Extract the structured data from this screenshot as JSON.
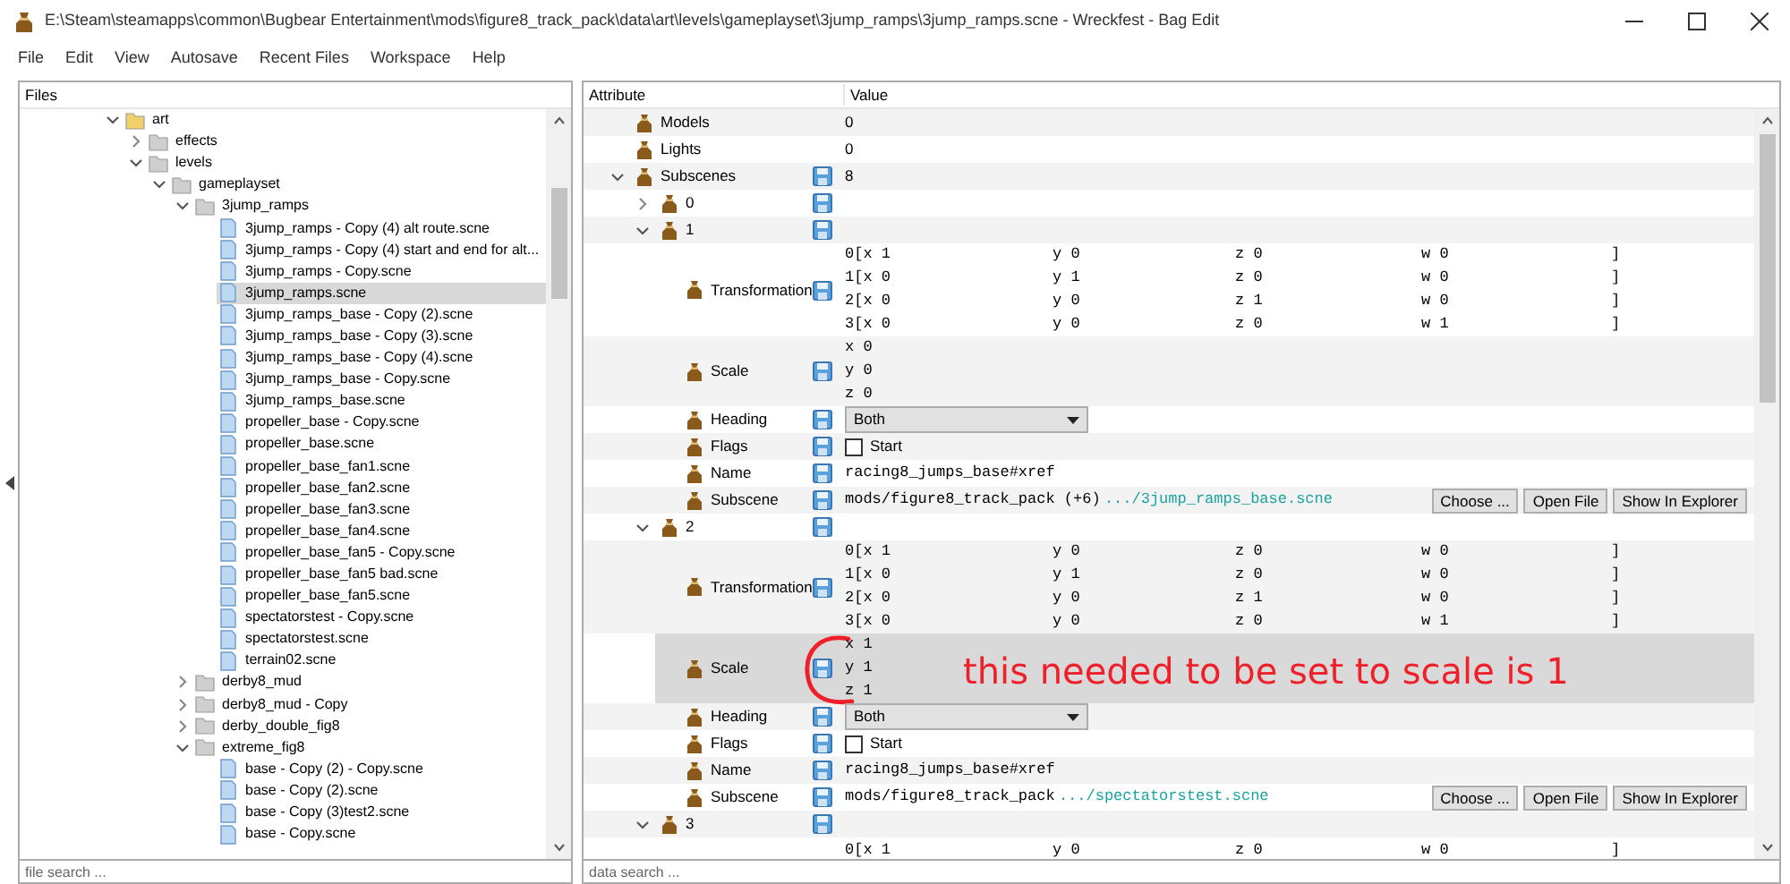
{
  "window": {
    "title": "E:\\Steam\\steamapps\\common\\Bugbear Entertainment\\mods\\figure8_track_pack\\data\\art\\levels\\gameplayset\\3jump_ramps\\3jump_ramps.scne - Wreckfest - Bag Edit"
  },
  "menu": [
    "File",
    "Edit",
    "View",
    "Autosave",
    "Recent Files",
    "Workspace",
    "Help"
  ],
  "files_panel": {
    "title": "Files",
    "search_placeholder": "file search ...",
    "tree": [
      {
        "kind": "folder",
        "label": "art",
        "color": "#f2d06b",
        "expanded": true,
        "selected": false,
        "children": [
          {
            "kind": "folder",
            "label": "effects",
            "color": "#cfcfcf",
            "expanded": false,
            "selected": false
          },
          {
            "kind": "folder",
            "label": "levels",
            "color": "#cfcfcf",
            "expanded": true,
            "selected": false,
            "children": [
              {
                "kind": "folder",
                "label": "gameplayset",
                "color": "#cfcfcf",
                "expanded": true,
                "selected": false,
                "children": [
                  {
                    "kind": "folder",
                    "label": "3jump_ramps",
                    "color": "#cfcfcf",
                    "expanded": true,
                    "selected": false,
                    "children": [
                      {
                        "kind": "file",
                        "label": "3jump_ramps - Copy (4) alt route.scne",
                        "selected": false
                      },
                      {
                        "kind": "file",
                        "label": "3jump_ramps - Copy (4) start and end for alt...",
                        "selected": false
                      },
                      {
                        "kind": "file",
                        "label": "3jump_ramps - Copy.scne",
                        "selected": false
                      },
                      {
                        "kind": "file",
                        "label": "3jump_ramps.scne",
                        "selected": true
                      },
                      {
                        "kind": "file",
                        "label": "3jump_ramps_base - Copy (2).scne",
                        "selected": false
                      },
                      {
                        "kind": "file",
                        "label": "3jump_ramps_base - Copy (3).scne",
                        "selected": false
                      },
                      {
                        "kind": "file",
                        "label": "3jump_ramps_base - Copy (4).scne",
                        "selected": false
                      },
                      {
                        "kind": "file",
                        "label": "3jump_ramps_base - Copy.scne",
                        "selected": false
                      },
                      {
                        "kind": "file",
                        "label": "3jump_ramps_base.scne",
                        "selected": false
                      },
                      {
                        "kind": "file",
                        "label": "propeller_base - Copy.scne",
                        "selected": false
                      },
                      {
                        "kind": "file",
                        "label": "propeller_base.scne",
                        "selected": false
                      },
                      {
                        "kind": "file",
                        "label": "propeller_base_fan1.scne",
                        "selected": false
                      },
                      {
                        "kind": "file",
                        "label": "propeller_base_fan2.scne",
                        "selected": false
                      },
                      {
                        "kind": "file",
                        "label": "propeller_base_fan3.scne",
                        "selected": false
                      },
                      {
                        "kind": "file",
                        "label": "propeller_base_fan4.scne",
                        "selected": false
                      },
                      {
                        "kind": "file",
                        "label": "propeller_base_fan5 - Copy.scne",
                        "selected": false
                      },
                      {
                        "kind": "file",
                        "label": "propeller_base_fan5 bad.scne",
                        "selected": false
                      },
                      {
                        "kind": "file",
                        "label": "propeller_base_fan5.scne",
                        "selected": false
                      },
                      {
                        "kind": "file",
                        "label": "spectatorstest - Copy.scne",
                        "selected": false
                      },
                      {
                        "kind": "file",
                        "label": "spectatorstest.scne",
                        "selected": false
                      },
                      {
                        "kind": "file",
                        "label": "terrain02.scne",
                        "selected": false
                      }
                    ]
                  },
                  {
                    "kind": "folder",
                    "label": "derby8_mud",
                    "color": "#cfcfcf",
                    "expanded": false,
                    "selected": false
                  },
                  {
                    "kind": "folder",
                    "label": "derby8_mud - Copy",
                    "color": "#cfcfcf",
                    "expanded": false,
                    "selected": false
                  },
                  {
                    "kind": "folder",
                    "label": "derby_double_fig8",
                    "color": "#cfcfcf",
                    "expanded": false,
                    "selected": false
                  },
                  {
                    "kind": "folder",
                    "label": "extreme_fig8",
                    "color": "#cfcfcf",
                    "expanded": true,
                    "selected": false,
                    "children": [
                      {
                        "kind": "file",
                        "label": "base - Copy (2) - Copy.scne",
                        "selected": false
                      },
                      {
                        "kind": "file",
                        "label": "base - Copy (2).scne",
                        "selected": false
                      },
                      {
                        "kind": "file",
                        "label": "base - Copy (3)test2.scne",
                        "selected": false
                      },
                      {
                        "kind": "file",
                        "label": "base - Copy.scne",
                        "selected": false
                      }
                    ]
                  }
                ]
              }
            ]
          }
        ]
      }
    ]
  },
  "data_panel": {
    "columns": [
      "Attribute",
      "Value"
    ],
    "search_placeholder": "data search ...",
    "rows": [
      {
        "kind": "text",
        "label": "Models",
        "value": "0",
        "save_icon": false,
        "selected": false
      },
      {
        "kind": "text",
        "label": "Lights",
        "value": "0",
        "save_icon": false,
        "selected": false
      },
      {
        "kind": "text",
        "label": "Subscenes",
        "value": "8",
        "save_icon": true,
        "expanded": true,
        "selected": false,
        "children": [
          {
            "label": "0",
            "save_icon": true,
            "expanded": false,
            "selected": false
          },
          {
            "label": "1",
            "save_icon": true,
            "expanded": true,
            "selected": false,
            "children": [
              {
                "kind": "matrix",
                "label": "Transformation",
                "save_icon": true,
                "selected": false,
                "rows": [
                  [
                    "0[x 1",
                    "y 0",
                    "z 0",
                    "w 0",
                    "]"
                  ],
                  [
                    "1[x 0",
                    "y 1",
                    "z 0",
                    "w 0",
                    "]"
                  ],
                  [
                    "2[x 0",
                    "y 0",
                    "z 1",
                    "w 0",
                    "]"
                  ],
                  [
                    "3[x 0",
                    "y 0",
                    "z 0",
                    "w 1",
                    "]"
                  ]
                ]
              },
              {
                "kind": "vector",
                "label": "Scale",
                "save_icon": true,
                "selected": false,
                "lines": [
                  "x 0",
                  "y 0",
                  "z 0"
                ]
              },
              {
                "kind": "dropdown",
                "label": "Heading",
                "save_icon": true,
                "selected": false,
                "value": "Both"
              },
              {
                "kind": "checkbox",
                "label": "Flags",
                "save_icon": true,
                "selected": false,
                "checked": false,
                "text": "Start"
              },
              {
                "kind": "mono",
                "label": "Name",
                "save_icon": true,
                "selected": false,
                "value": "racing8_jumps_base#xref"
              },
              {
                "kind": "path",
                "label": "Subscene",
                "save_icon": true,
                "selected": false,
                "path": "mods/figure8_track_pack (+6)",
                "file": ".../3jump_ramps_base.scne",
                "buttons": [
                  "Choose ...",
                  "Open File",
                  "Show In Explorer"
                ]
              }
            ]
          },
          {
            "label": "2",
            "save_icon": true,
            "expanded": true,
            "selected": false,
            "children": [
              {
                "kind": "matrix",
                "label": "Transformation",
                "save_icon": true,
                "selected": false,
                "rows": [
                  [
                    "0[x 1",
                    "y 0",
                    "z 0",
                    "w 0",
                    "]"
                  ],
                  [
                    "1[x 0",
                    "y 1",
                    "z 0",
                    "w 0",
                    "]"
                  ],
                  [
                    "2[x 0",
                    "y 0",
                    "z 1",
                    "w 0",
                    "]"
                  ],
                  [
                    "3[x 0",
                    "y 0",
                    "z 0",
                    "w 1",
                    "]"
                  ]
                ]
              },
              {
                "kind": "vector",
                "label": "Scale",
                "save_icon": true,
                "selected": true,
                "lines": [
                  "x 1",
                  "y 1",
                  "z 1"
                ],
                "annotation": "this needed to be set to scale is 1"
              },
              {
                "kind": "dropdown",
                "label": "Heading",
                "save_icon": true,
                "selected": false,
                "value": "Both"
              },
              {
                "kind": "checkbox",
                "label": "Flags",
                "save_icon": true,
                "selected": false,
                "checked": false,
                "text": "Start"
              },
              {
                "kind": "mono",
                "label": "Name",
                "save_icon": true,
                "selected": false,
                "value": "racing8_jumps_base#xref"
              },
              {
                "kind": "path",
                "label": "Subscene",
                "save_icon": true,
                "selected": false,
                "path": "mods/figure8_track_pack",
                "file": ".../spectatorstest.scne",
                "buttons": [
                  "Choose ...",
                  "Open File",
                  "Show In Explorer"
                ]
              }
            ]
          },
          {
            "label": "3",
            "save_icon": true,
            "expanded": true,
            "selected": false,
            "children": [
              {
                "kind": "matrix",
                "save_icon": false,
                "selected": false,
                "rows": [
                  [
                    "0[x 1",
                    "y 0",
                    "z 0",
                    "w 0",
                    "]"
                  ]
                ]
              }
            ]
          }
        ]
      }
    ]
  }
}
